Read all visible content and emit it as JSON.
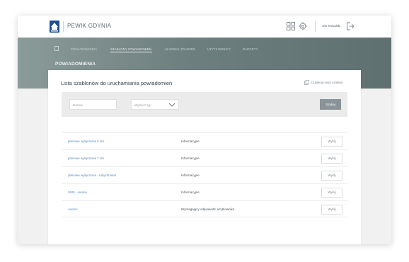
{
  "header": {
    "brand": "PEWIK GDYNIA",
    "user_name": "Jan Kowalski",
    "icons": [
      "grid-icon",
      "gear-icon",
      "logout-icon"
    ]
  },
  "nav": {
    "items": [
      {
        "label": "POWIADOMIENIA",
        "active": false
      },
      {
        "label": "SZABLONY POWIADOMIEŃ",
        "active": true
      },
      {
        "label": "SŁOWNIK ZDARZEŃ",
        "active": false
      },
      {
        "label": "UŻYTKOWNICY",
        "active": false
      },
      {
        "label": "RAPORTY",
        "active": false
      }
    ]
  },
  "section": {
    "title": "POWIADOMIENIA"
  },
  "card": {
    "title": "Lista szablonów do uruchamiania powiadomień",
    "duplicate_label": "Duplikuj nowy szablon"
  },
  "filter": {
    "name_placeholder": "Nazwa",
    "type_placeholder": "Wybierz typ",
    "search_label": "Szukaj"
  },
  "table": {
    "rows": [
      {
        "name": "planowe wyłączenia 5 dni",
        "type": "Informacyjne",
        "action": "Wyślij"
      },
      {
        "name": "planowe wyłączenia 7 dni",
        "type": "Informacyjne",
        "action": "Wyślij"
      },
      {
        "name": "planowe wyłączenia - natychmiast",
        "type": "Informacyjne",
        "action": "Wyślij"
      },
      {
        "name": "SMS - awarie",
        "type": "Informacyjne",
        "action": "Wyślij"
      },
      {
        "name": "Awarie",
        "type": "Wymagający odpowiedzi użytkownika",
        "action": "Wyślij"
      }
    ]
  },
  "colors": {
    "accent_link": "#5b8cc4",
    "hero": "#6e7f7f",
    "button": "#8a9498"
  }
}
